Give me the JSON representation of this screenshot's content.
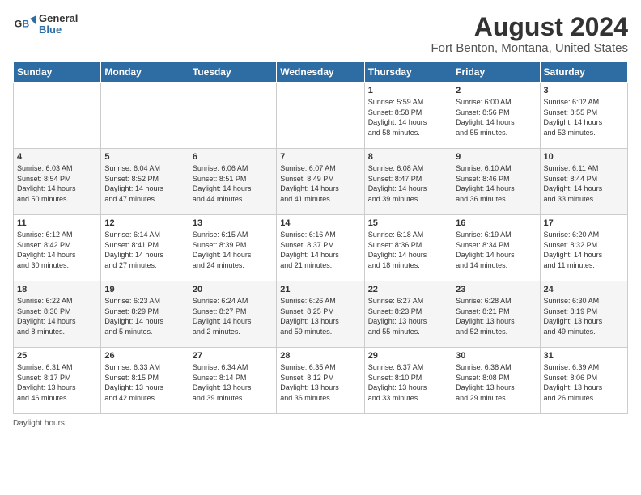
{
  "header": {
    "logo_line1": "General",
    "logo_line2": "Blue",
    "title": "August 2024",
    "subtitle": "Fort Benton, Montana, United States"
  },
  "days_of_week": [
    "Sunday",
    "Monday",
    "Tuesday",
    "Wednesday",
    "Thursday",
    "Friday",
    "Saturday"
  ],
  "weeks": [
    [
      {
        "day": "",
        "info": ""
      },
      {
        "day": "",
        "info": ""
      },
      {
        "day": "",
        "info": ""
      },
      {
        "day": "",
        "info": ""
      },
      {
        "day": "1",
        "info": "Sunrise: 5:59 AM\nSunset: 8:58 PM\nDaylight: 14 hours\nand 58 minutes."
      },
      {
        "day": "2",
        "info": "Sunrise: 6:00 AM\nSunset: 8:56 PM\nDaylight: 14 hours\nand 55 minutes."
      },
      {
        "day": "3",
        "info": "Sunrise: 6:02 AM\nSunset: 8:55 PM\nDaylight: 14 hours\nand 53 minutes."
      }
    ],
    [
      {
        "day": "4",
        "info": "Sunrise: 6:03 AM\nSunset: 8:54 PM\nDaylight: 14 hours\nand 50 minutes."
      },
      {
        "day": "5",
        "info": "Sunrise: 6:04 AM\nSunset: 8:52 PM\nDaylight: 14 hours\nand 47 minutes."
      },
      {
        "day": "6",
        "info": "Sunrise: 6:06 AM\nSunset: 8:51 PM\nDaylight: 14 hours\nand 44 minutes."
      },
      {
        "day": "7",
        "info": "Sunrise: 6:07 AM\nSunset: 8:49 PM\nDaylight: 14 hours\nand 41 minutes."
      },
      {
        "day": "8",
        "info": "Sunrise: 6:08 AM\nSunset: 8:47 PM\nDaylight: 14 hours\nand 39 minutes."
      },
      {
        "day": "9",
        "info": "Sunrise: 6:10 AM\nSunset: 8:46 PM\nDaylight: 14 hours\nand 36 minutes."
      },
      {
        "day": "10",
        "info": "Sunrise: 6:11 AM\nSunset: 8:44 PM\nDaylight: 14 hours\nand 33 minutes."
      }
    ],
    [
      {
        "day": "11",
        "info": "Sunrise: 6:12 AM\nSunset: 8:42 PM\nDaylight: 14 hours\nand 30 minutes."
      },
      {
        "day": "12",
        "info": "Sunrise: 6:14 AM\nSunset: 8:41 PM\nDaylight: 14 hours\nand 27 minutes."
      },
      {
        "day": "13",
        "info": "Sunrise: 6:15 AM\nSunset: 8:39 PM\nDaylight: 14 hours\nand 24 minutes."
      },
      {
        "day": "14",
        "info": "Sunrise: 6:16 AM\nSunset: 8:37 PM\nDaylight: 14 hours\nand 21 minutes."
      },
      {
        "day": "15",
        "info": "Sunrise: 6:18 AM\nSunset: 8:36 PM\nDaylight: 14 hours\nand 18 minutes."
      },
      {
        "day": "16",
        "info": "Sunrise: 6:19 AM\nSunset: 8:34 PM\nDaylight: 14 hours\nand 14 minutes."
      },
      {
        "day": "17",
        "info": "Sunrise: 6:20 AM\nSunset: 8:32 PM\nDaylight: 14 hours\nand 11 minutes."
      }
    ],
    [
      {
        "day": "18",
        "info": "Sunrise: 6:22 AM\nSunset: 8:30 PM\nDaylight: 14 hours\nand 8 minutes."
      },
      {
        "day": "19",
        "info": "Sunrise: 6:23 AM\nSunset: 8:29 PM\nDaylight: 14 hours\nand 5 minutes."
      },
      {
        "day": "20",
        "info": "Sunrise: 6:24 AM\nSunset: 8:27 PM\nDaylight: 14 hours\nand 2 minutes."
      },
      {
        "day": "21",
        "info": "Sunrise: 6:26 AM\nSunset: 8:25 PM\nDaylight: 13 hours\nand 59 minutes."
      },
      {
        "day": "22",
        "info": "Sunrise: 6:27 AM\nSunset: 8:23 PM\nDaylight: 13 hours\nand 55 minutes."
      },
      {
        "day": "23",
        "info": "Sunrise: 6:28 AM\nSunset: 8:21 PM\nDaylight: 13 hours\nand 52 minutes."
      },
      {
        "day": "24",
        "info": "Sunrise: 6:30 AM\nSunset: 8:19 PM\nDaylight: 13 hours\nand 49 minutes."
      }
    ],
    [
      {
        "day": "25",
        "info": "Sunrise: 6:31 AM\nSunset: 8:17 PM\nDaylight: 13 hours\nand 46 minutes."
      },
      {
        "day": "26",
        "info": "Sunrise: 6:33 AM\nSunset: 8:15 PM\nDaylight: 13 hours\nand 42 minutes."
      },
      {
        "day": "27",
        "info": "Sunrise: 6:34 AM\nSunset: 8:14 PM\nDaylight: 13 hours\nand 39 minutes."
      },
      {
        "day": "28",
        "info": "Sunrise: 6:35 AM\nSunset: 8:12 PM\nDaylight: 13 hours\nand 36 minutes."
      },
      {
        "day": "29",
        "info": "Sunrise: 6:37 AM\nSunset: 8:10 PM\nDaylight: 13 hours\nand 33 minutes."
      },
      {
        "day": "30",
        "info": "Sunrise: 6:38 AM\nSunset: 8:08 PM\nDaylight: 13 hours\nand 29 minutes."
      },
      {
        "day": "31",
        "info": "Sunrise: 6:39 AM\nSunset: 8:06 PM\nDaylight: 13 hours\nand 26 minutes."
      }
    ]
  ],
  "footer": {
    "note": "Daylight hours"
  }
}
